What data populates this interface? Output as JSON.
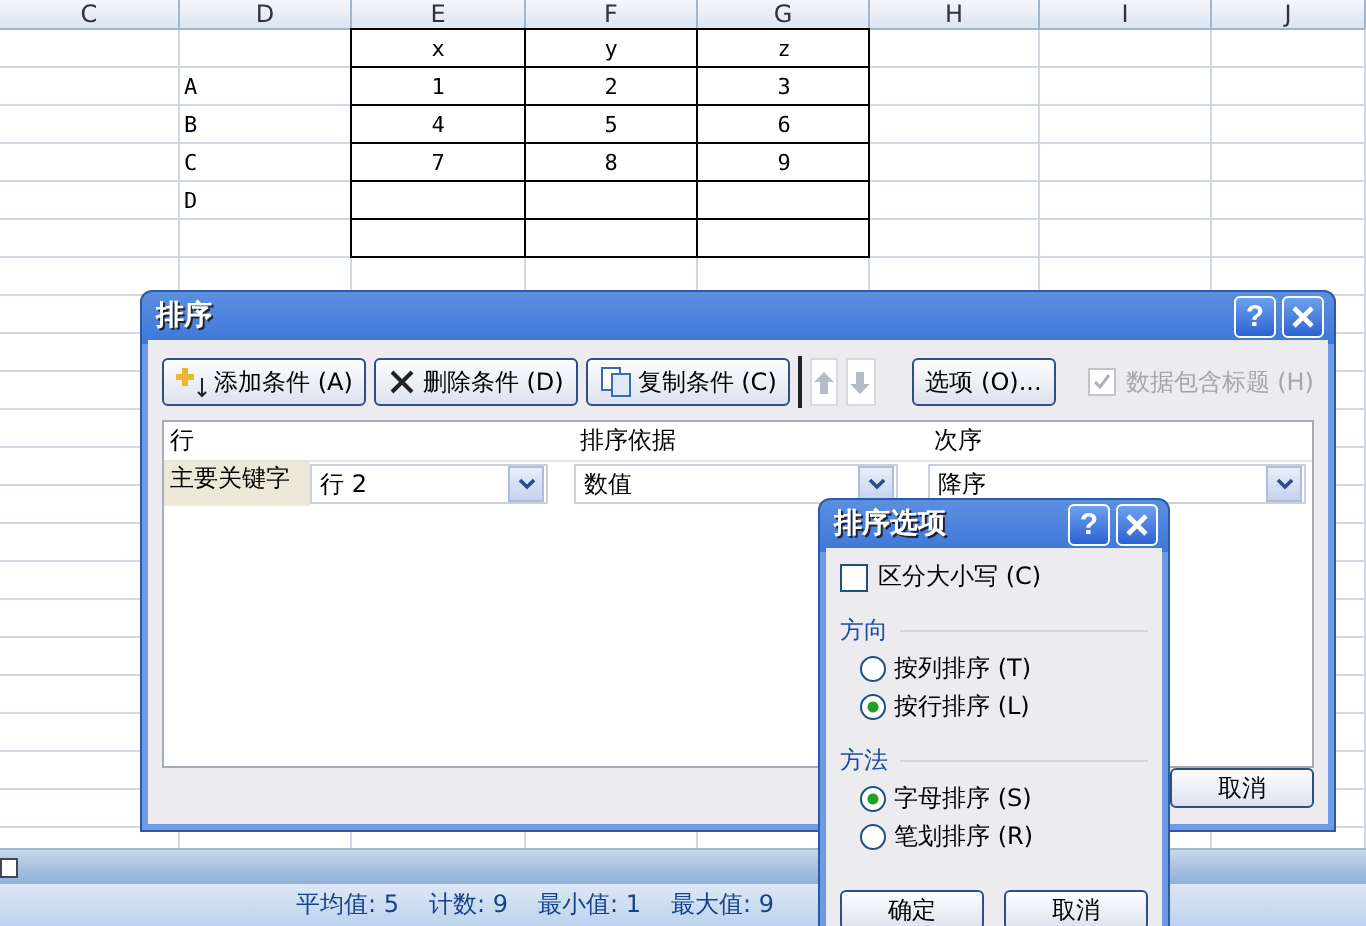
{
  "sheet": {
    "columns": [
      "C",
      "D",
      "E",
      "F",
      "G",
      "H",
      "I",
      "J"
    ],
    "header_row": [
      "x",
      "y",
      "z"
    ],
    "rows": [
      {
        "label": "A",
        "values": [
          "1",
          "2",
          "3"
        ]
      },
      {
        "label": "B",
        "values": [
          "4",
          "5",
          "6"
        ]
      },
      {
        "label": "C",
        "values": [
          "7",
          "8",
          "9"
        ]
      },
      {
        "label": "D"
      }
    ]
  },
  "status_bar": [
    "平均值: 5",
    "计数: 9",
    "最小值: 1",
    "最大值: 9"
  ],
  "sort_dialog": {
    "title": "排序",
    "help": "?",
    "toolbar": [
      {
        "kind": "add",
        "label": "添加条件 (A)"
      },
      {
        "kind": "delete",
        "label": "删除条件 (D)"
      },
      {
        "kind": "copy",
        "label": "复制条件 (C)"
      },
      {
        "kind": "up",
        "disabled": true
      },
      {
        "kind": "down",
        "disabled": true
      },
      {
        "kind": "options",
        "label": "选项 (O)..."
      }
    ],
    "header_checkbox": {
      "label": "数据包含标题 (H)",
      "checked": true,
      "disabled": true
    },
    "columns": [
      "行",
      "排序依据",
      "次序"
    ],
    "levels": [
      {
        "label": "主要关键字",
        "key": "行 2",
        "basis": "数值",
        "order": "降序"
      }
    ],
    "buttons": [
      "取消"
    ]
  },
  "options_dialog": {
    "title": "排序选项",
    "help": "?",
    "case_sensitive": {
      "label": "区分大小写 (C)",
      "checked": false
    },
    "groups": [
      {
        "title": "方向",
        "options": [
          {
            "label": "按列排序 (T)",
            "selected": false
          },
          {
            "label": "按行排序 (L)",
            "selected": true
          }
        ]
      },
      {
        "title": "方法",
        "options": [
          {
            "label": "字母排序 (S)",
            "selected": true
          },
          {
            "label": "笔划排序 (R)",
            "selected": false
          }
        ]
      }
    ],
    "buttons": [
      "确定",
      "取消"
    ]
  }
}
